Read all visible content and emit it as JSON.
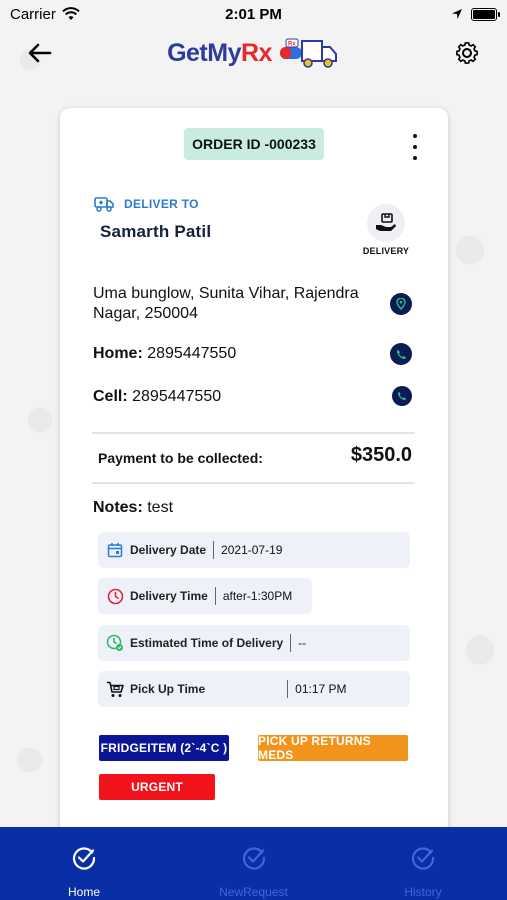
{
  "status_bar": {
    "carrier": "Carrier",
    "time": "2:01 PM"
  },
  "header": {
    "logo_text_main": "GetMy",
    "logo_text_rx": "Rx",
    "logo_badge": "Rx"
  },
  "order": {
    "order_id": "ORDER ID -000233",
    "deliver_to_label": "DELIVER TO",
    "customer_name": "Samarth Patil",
    "delivery_type_label": "DELIVERY",
    "address": "Uma bunglow, Sunita Vihar, Rajendra Nagar, 250004",
    "home_label": "Home:",
    "home_phone": "2895447550",
    "cell_label": "Cell:",
    "cell_phone": "2895447550",
    "payment_label": "Payment to be collected:",
    "payment_amount": "$350.0",
    "notes_label": "Notes:",
    "notes_value": "test",
    "delivery_date_label": "Delivery Date",
    "delivery_date_value": "2021-07-19",
    "delivery_time_label": "Delivery Time",
    "delivery_time_value": "after-1:30PM",
    "eta_label": "Estimated Time of Delivery",
    "eta_value": "--",
    "pickup_time_label": "Pick Up Time",
    "pickup_time_value": "01:17 PM"
  },
  "tags": {
    "fridge": "FRIDGEITEM (2`-4`C )",
    "pickup_returns": "PICK UP RETURNS MEDS",
    "urgent": "URGENT"
  },
  "nav": {
    "items": [
      {
        "label": "Home",
        "active": true
      },
      {
        "label": "NewRequest",
        "active": false
      },
      {
        "label": "History",
        "active": false
      }
    ]
  },
  "colors": {
    "nav_bg": "#0a2ea6",
    "fridge_tag": "#0a1596",
    "pickup_tag": "#f2941c",
    "urgent_tag": "#f2121a",
    "order_badge": "#c9ece2",
    "deliver_to_accent": "#2a7bd5"
  }
}
